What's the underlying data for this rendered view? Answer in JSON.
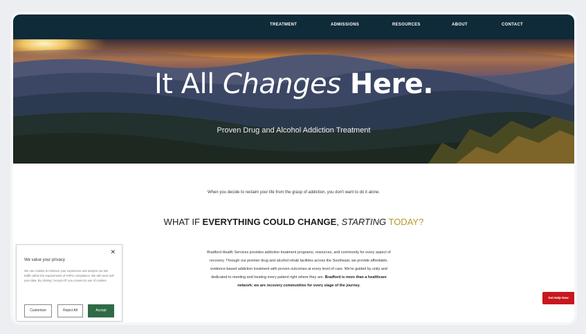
{
  "nav": {
    "items": [
      {
        "label": "TREATMENT"
      },
      {
        "label": "ADMISSIONS"
      },
      {
        "label": "RESOURCES"
      },
      {
        "label": "ABOUT"
      },
      {
        "label": "CONTACT"
      }
    ]
  },
  "hero": {
    "title_part1": "It All ",
    "title_part2": "Changes",
    "title_part3": " Here.",
    "subtitle": "Proven Drug and Alcohol Addiction Treatment"
  },
  "intro": {
    "text": "When you decide to reclaim your life from the grasp of addiction, you don't want to do it alone."
  },
  "headline": {
    "part1": "WHAT IF ",
    "part2": "EVERYTHING COULD CHANGE",
    "part3": ", ",
    "part4": "STARTING",
    "part5": " TODAY?"
  },
  "body": {
    "text": "Bradford Health Services provides addiction treatment programs, resources, and community for every aspect of recovery. Through our premier drug and alcohol rehab facilities across the Southeast, we provide affordable, evidence-based addiction treatment with proven outcomes at every level of care. We're guided by unity and dedicated to meeting and treating every patient right where they are. ",
    "bold_text": "Bradford is more than a healthcare network; we are recovery communities for every stage of the journey."
  },
  "help_button": {
    "label": "Get Help Now"
  },
  "cookie": {
    "close_icon": "close-icon",
    "title": "We value your privacy",
    "text": "We use cookies to enhance your experience and analyze our site traffic within the requirements of HIPAA compliance. We will never sell your data. By clicking \"Accept All\" you consent to use of cookies.",
    "customize_label": "Customize",
    "reject_label": "Reject All",
    "accept_label": "Accept"
  },
  "colors": {
    "nav_bg": "#0f2a38",
    "accent_gold": "#b39a2c",
    "help_red": "#c8171e",
    "accept_green": "#2f6b46"
  }
}
